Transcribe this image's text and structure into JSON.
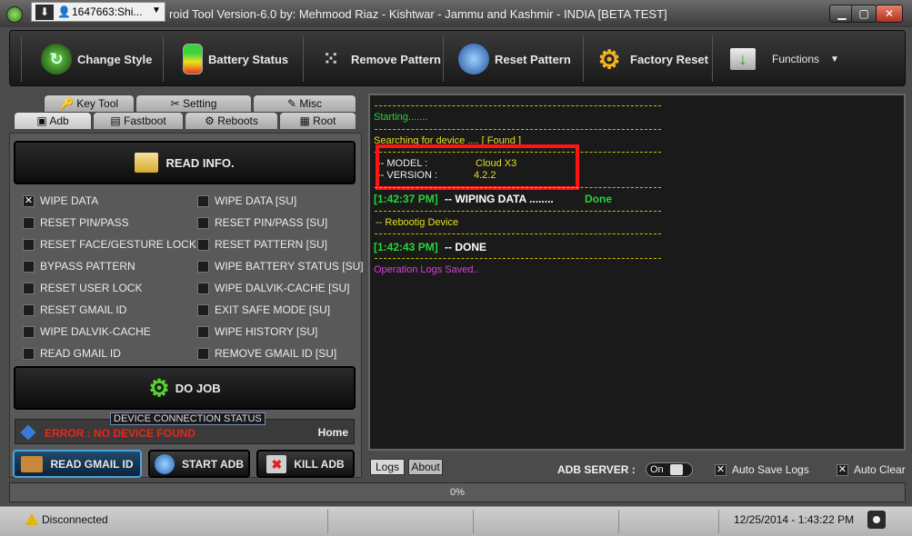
{
  "window": {
    "title": "roid Tool Version-6.0 by: Mehmood Riaz - Kishtwar - Jammu and Kashmir - INDIA    [BETA TEST]",
    "popup_tab": "1647663:Shi..."
  },
  "toolbar": [
    {
      "label": "Change Style",
      "icon": "change-style-icon"
    },
    {
      "label": "Battery Status",
      "icon": "battery-icon"
    },
    {
      "label": "Remove Pattern",
      "icon": "pattern-icon"
    },
    {
      "label": "Reset Pattern",
      "icon": "globe-icon"
    },
    {
      "label": "Factory Reset",
      "icon": "gears-icon"
    },
    {
      "label": "Functions",
      "icon": "mail-download-icon"
    }
  ],
  "tabs_top": [
    "Key Tool",
    "Setting",
    "Misc"
  ],
  "tabs_bottom": [
    "Adb",
    "Fastboot",
    "Reboots",
    "Root"
  ],
  "read_info": "READ INFO.",
  "options_left": [
    {
      "label": "WIPE DATA",
      "checked": true
    },
    {
      "label": "RESET PIN/PASS",
      "checked": false
    },
    {
      "label": "RESET FACE/GESTURE LOCK",
      "checked": false
    },
    {
      "label": "BYPASS PATTERN",
      "checked": false
    },
    {
      "label": "RESET USER LOCK",
      "checked": false
    },
    {
      "label": "RESET GMAIL ID",
      "checked": false
    },
    {
      "label": "WIPE DALVIK-CACHE",
      "checked": false
    },
    {
      "label": "READ GMAIL ID",
      "checked": false
    }
  ],
  "options_right": [
    {
      "label": "WIPE DATA [SU]",
      "checked": false
    },
    {
      "label": "RESET PIN/PASS [SU]",
      "checked": false
    },
    {
      "label": "RESET PATTERN [SU]",
      "checked": false
    },
    {
      "label": "WIPE BATTERY STATUS [SU]",
      "checked": false
    },
    {
      "label": "WIPE DALVIK-CACHE [SU]",
      "checked": false
    },
    {
      "label": "EXIT SAFE MODE [SU]",
      "checked": false
    },
    {
      "label": "WIPE HISTORY [SU]",
      "checked": false
    },
    {
      "label": "REMOVE GMAIL ID [SU]",
      "checked": false
    }
  ],
  "do_job": "DO JOB",
  "device_status": {
    "label": "DEVICE CONNECTION STATUS",
    "error": "ERROR : NO DEVICE FOUND",
    "home": "Home"
  },
  "actions": [
    "READ GMAIL ID",
    "START ADB",
    "KILL ADB"
  ],
  "log": {
    "starting": "Starting.......",
    "searching": "Searching for device ....    [ Found ]",
    "model_label": "-- MODEL    :",
    "model_value": "Cloud X3",
    "version_label": "-- VERSION   :",
    "version_value": "4.2.2",
    "wipe_time": "[1:42:37 PM]",
    "wipe_text": "--  WIPING DATA ........",
    "wipe_done": "Done",
    "reboot": "--  Rebootig Device",
    "done_time": "[1:42:43 PM]",
    "done_text": "--  DONE",
    "saved": "Operation Logs Saved.."
  },
  "log_tabs": [
    "Logs",
    "About"
  ],
  "adb_server_label": "ADB SERVER :",
  "adb_server_state": "On",
  "auto_save_logs": {
    "label": "Auto Save Logs",
    "checked": true
  },
  "auto_clear": {
    "label": "Auto Clear",
    "checked": true
  },
  "progress": {
    "text": "0%",
    "value": 0
  },
  "statusbar": {
    "connection": "Disconnected",
    "datetime": "12/25/2014  -  1:43:22 PM"
  },
  "colors": {
    "log_green": "#26d43a",
    "log_yellow": "#e6df22",
    "log_magenta": "#d93fd9",
    "error_red": "#e8261c",
    "highlight_red": "#ff1414"
  }
}
